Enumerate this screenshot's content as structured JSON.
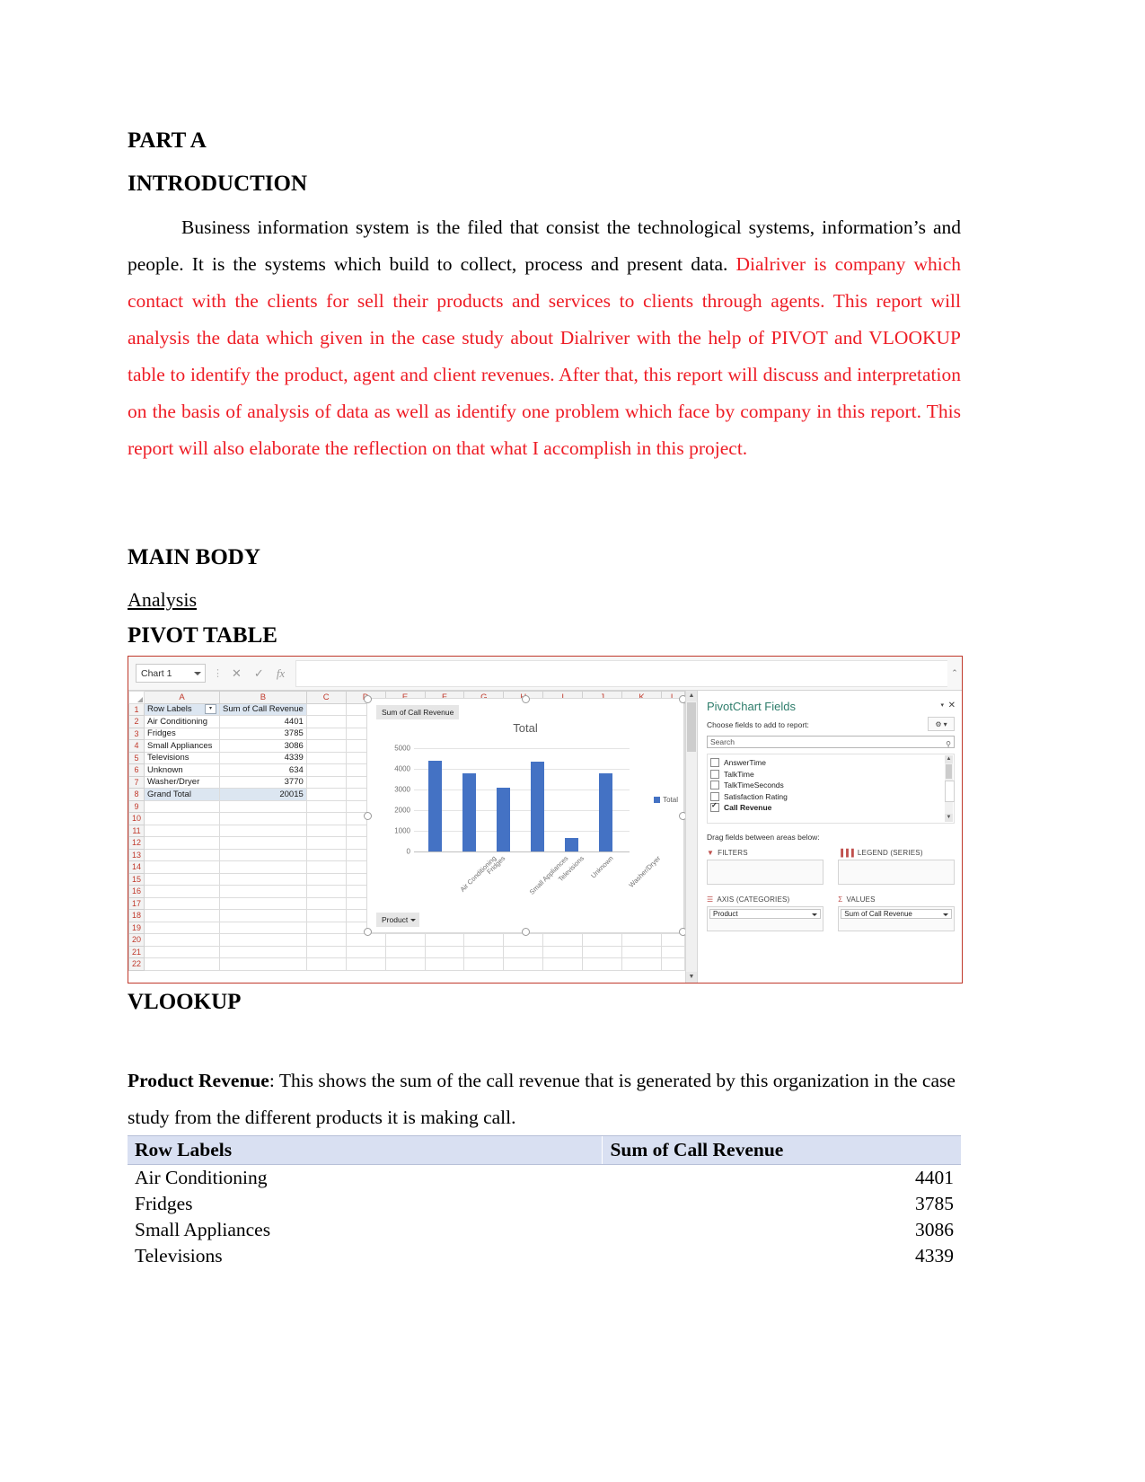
{
  "document": {
    "headings": {
      "part_a": "PART A",
      "introduction": "INTRODUCTION",
      "main_body": "MAIN BODY",
      "analysis": "Analysis",
      "pivot_table": "PIVOT TABLE",
      "vlookup": "VLOOKUP"
    },
    "paragraph_black": "Business information system is the filed that consist the technological systems, information’s and people. It is the systems which build to collect, process and present data. ",
    "paragraph_red": "Dialriver is company which contact with the clients for sell their products and services to clients through agents. This report will analysis the data which given in the case study about Dialriver with the help of PIVOT and VLOOKUP table to identify the product, agent and client revenues. After that, this report will discuss and interpretation on the basis of analysis of data as well as identify one problem which face by company in this report. This report will also elaborate the reflection on that what I accomplish in this project.",
    "product_revenue_label": "Product Revenue",
    "product_revenue_text": ": This shows the sum of the call revenue that is generated by this organization in the case study from the different products it is making call.",
    "red_color": "#ee1c25"
  },
  "excel": {
    "name_box": "Chart 1",
    "formula_bar_value": "",
    "cancel_icon": "✕",
    "accept_icon": "✓",
    "function_icon": "fx",
    "column_headers": [
      "A",
      "B",
      "C",
      "D",
      "E",
      "F",
      "G",
      "H",
      "I",
      "J",
      "K",
      "L"
    ],
    "row_numbers": [
      1,
      2,
      3,
      4,
      5,
      6,
      7,
      8,
      9,
      10,
      11,
      12,
      13,
      14,
      15,
      16,
      17,
      18,
      19,
      20,
      21,
      22
    ],
    "cells": {
      "header_a": "Row Labels",
      "header_b": "Sum of Call Revenue",
      "rows": [
        {
          "label": "Air Conditioning",
          "value": "4401"
        },
        {
          "label": "Fridges",
          "value": "3785"
        },
        {
          "label": "Small Appliances",
          "value": "3086"
        },
        {
          "label": "Televisions",
          "value": "4339"
        },
        {
          "label": "Unknown",
          "value": "634"
        },
        {
          "label": "Washer/Dryer",
          "value": "3770"
        },
        {
          "label": "Grand Total",
          "value": "20015"
        }
      ]
    }
  },
  "chart_data": {
    "type": "bar",
    "title": "Total",
    "value_field_button": "Sum of Call Revenue",
    "axis_field_button": "Product",
    "categories": [
      "Air Conditioning",
      "Fridges",
      "Small Appliances",
      "Televisions",
      "Unknown",
      "Washer/Dryer"
    ],
    "values": [
      4401,
      3785,
      3086,
      4339,
      634,
      3770
    ],
    "series": [
      {
        "name": "Total",
        "values": [
          4401,
          3785,
          3086,
          4339,
          634,
          3770
        ]
      }
    ],
    "legend": [
      "Total"
    ],
    "legend_position": "right",
    "ylim": [
      0,
      5000
    ],
    "yticks": [
      0,
      1000,
      2000,
      3000,
      4000,
      5000
    ],
    "xlabel": "",
    "ylabel": "",
    "grid": true,
    "bar_color": "#4472c4"
  },
  "pivot_pane": {
    "title": "PivotChart Fields",
    "close_icon": "✕",
    "dropdown_icon": "▾",
    "subtitle": "Choose fields to add to report:",
    "gear_icon": "⚙",
    "gear_caret": "▾",
    "search_placeholder": "Search",
    "search_icon": "⚲",
    "fields": [
      {
        "name": "AnswerTime",
        "checked": false
      },
      {
        "name": "TalkTime",
        "checked": false
      },
      {
        "name": "TalkTimeSeconds",
        "checked": false
      },
      {
        "name": "Satisfaction Rating",
        "checked": false
      },
      {
        "name": "Call Revenue",
        "checked": true
      }
    ],
    "drag_text": "Drag fields between areas below:",
    "areas": [
      {
        "key": "filters",
        "label": "FILTERS",
        "icon": "▼",
        "chip": ""
      },
      {
        "key": "legend",
        "label": "LEGEND (SERIES)",
        "icon": "▐▐▐",
        "chip": ""
      },
      {
        "key": "axis",
        "label": "AXIS (CATEGORIES)",
        "icon": "☰",
        "chip": "Product"
      },
      {
        "key": "values",
        "label": "VALUES",
        "icon": "Σ",
        "chip": "Sum of Call Revenue"
      }
    ]
  },
  "vlookup_table": {
    "columns": [
      "Row Labels",
      "Sum of Call Revenue"
    ],
    "rows": [
      {
        "label": "Air Conditioning",
        "value": "4401"
      },
      {
        "label": "Fridges",
        "value": "3785"
      },
      {
        "label": "Small Appliances",
        "value": "3086"
      },
      {
        "label": "Televisions",
        "value": "4339"
      }
    ]
  }
}
